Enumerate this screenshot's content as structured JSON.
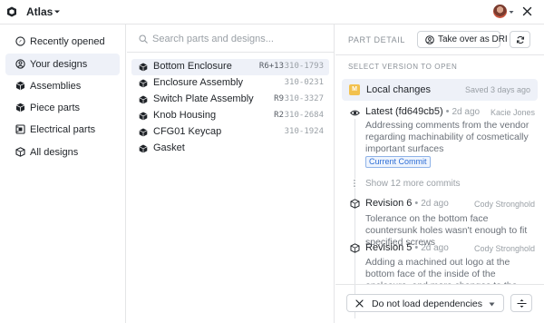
{
  "app": {
    "title": "Atlas"
  },
  "sidebar": {
    "items": [
      {
        "label": "Recently opened",
        "icon": "clock-icon",
        "active": false
      },
      {
        "label": "Your designs",
        "icon": "user-circle-icon",
        "active": true
      },
      {
        "label": "Assemblies",
        "icon": "cube-icon",
        "active": false
      },
      {
        "label": "Piece parts",
        "icon": "box-icon",
        "active": false
      },
      {
        "label": "Electrical parts",
        "icon": "chip-icon",
        "active": false
      },
      {
        "label": "All designs",
        "icon": "cube-outline-icon",
        "active": false
      }
    ]
  },
  "search": {
    "placeholder": "Search parts and designs...",
    "value": ""
  },
  "parts": [
    {
      "name": "Bottom Enclosure",
      "rev": "R6+13",
      "number": "310-1793",
      "active": true
    },
    {
      "name": "Enclosure Assembly",
      "rev": "",
      "number": "310-0231",
      "active": false
    },
    {
      "name": "Switch Plate Assembly",
      "rev": "R9",
      "number": "310-3327",
      "active": false
    },
    {
      "name": "Knob Housing",
      "rev": "R2",
      "number": "310-2684",
      "active": false
    },
    {
      "name": "CFG01 Keycap",
      "rev": "",
      "number": "310-1924",
      "active": false
    },
    {
      "name": "Gasket",
      "rev": "",
      "number": "",
      "active": false
    }
  ],
  "detail": {
    "label": "PART DETAIL",
    "dri_button": "Take over as DRI",
    "select_label": "SELECT VERSION TO OPEN",
    "local": {
      "badge": "M",
      "name": "Local changes",
      "saved": "Saved 3 days ago"
    },
    "latest": {
      "name": "Latest (fd649cb5)",
      "time": "2d ago",
      "author": "Kacie Jones",
      "description": "Addressing comments from the vendor regarding machinability of cosmetically important surfaces",
      "badge": "Current Commit"
    },
    "more_commits": "Show 12 more commits",
    "revisions": [
      {
        "name": "Revision 6",
        "time": "2d ago",
        "author": "Cody Stronghold",
        "description": "Tolerance on the bottom face countersunk holes wasn't enough to fit specified screws"
      },
      {
        "name": "Revision 5",
        "time": "2d ago",
        "author": "Cody Stronghold",
        "description": "Adding a machined out logo at the bottom face of the inside of the enclosure, and more changes to the thickness of the walls"
      }
    ],
    "dependencies": {
      "selected": "Do not load dependencies"
    }
  },
  "colors": {
    "accent_bg": "#eef1f8",
    "local_badge": "#f2c14e",
    "commit_badge": "#2f6fd6"
  }
}
